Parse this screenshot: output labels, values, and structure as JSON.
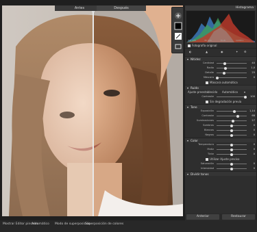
{
  "view_tabs": {
    "before": "Antes",
    "after": "Después"
  },
  "panel": {
    "header": "Histograma",
    "histogram_stats": [
      "ISO 125",
      "35 mm",
      "f/1.8",
      "1/200 s"
    ],
    "original_photo_label": "Fotografía original",
    "tools_tabs": [
      "Básico",
      "Detalle",
      "Color",
      "HSL"
    ],
    "sharpen": {
      "title": "Nitidez",
      "sliders": [
        {
          "label": "Cantidad",
          "value": "40",
          "level": 0.27
        },
        {
          "label": "Radio",
          "value": "1,0",
          "level": 0.3
        },
        {
          "label": "Detalle",
          "value": "25",
          "level": 0.25
        },
        {
          "label": "Máscara",
          "value": "0",
          "level": 0.02
        }
      ],
      "auto_mask": "Máscara automática"
    },
    "noise": {
      "title": "Ruido",
      "option": "Ajuste preestablecido",
      "preset": "Automático",
      "contrast_label": "Contraste",
      "contrast_value": "100",
      "checkbox": "Sin degradación previa"
    },
    "tone": {
      "title": "Tono",
      "sliders": [
        {
          "label": "Exposición",
          "value": "1,14",
          "level": 0.6
        },
        {
          "label": "Contraste",
          "value": "68",
          "level": 0.7
        },
        {
          "label": "Iluminaciones",
          "value": "27",
          "level": 0.55
        },
        {
          "label": "Sombras",
          "value": "0",
          "level": 0.5
        },
        {
          "label": "Blancos",
          "value": "0",
          "level": 0.5
        },
        {
          "label": "Negros",
          "value": "0",
          "level": 0.5
        }
      ]
    },
    "color": {
      "title": "Color",
      "sliders": [
        {
          "label": "Temperatura",
          "value": "0",
          "level": 0.5
        },
        {
          "label": "Matiz",
          "value": "0",
          "level": 0.5
        },
        {
          "label": "Tinte",
          "value": "0",
          "level": 0.5
        }
      ],
      "checkbox": "Utilizar Ajuste preciso",
      "sliders2": [
        {
          "label": "Saturación",
          "value": "0",
          "level": 0.5
        },
        {
          "label": "Intensidad",
          "value": "0",
          "level": 0.5
        }
      ]
    },
    "more": "Dividir tonos",
    "buttons": {
      "auto": "Anterior",
      "reset": "Restaurar"
    }
  },
  "statusbar": {
    "left_label": "Mostrar Editor pinceles",
    "left_value": "Automático",
    "mid_label": "Modo de superposición",
    "mid_value": "Superposición de colores"
  },
  "colors": {
    "panel": "#2e2e2e",
    "accent": "#e6e6e6"
  }
}
